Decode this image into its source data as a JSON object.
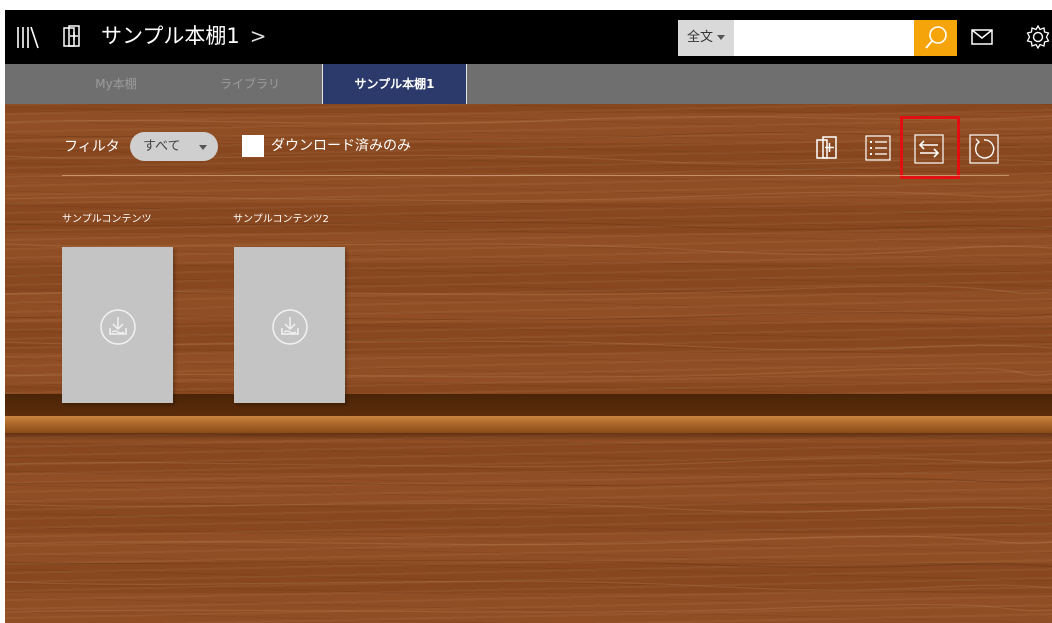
{
  "header": {
    "shelf_title": "サンプル本棚1",
    "chevron": ">",
    "search_scope": "全文",
    "search_value": "",
    "search_placeholder": ""
  },
  "tabs": [
    {
      "label": "My本棚",
      "active": false
    },
    {
      "label": "ライブラリ",
      "active": false
    },
    {
      "label": "サンプル本棚1",
      "active": true
    }
  ],
  "filter": {
    "label": "フィルタ",
    "selected": "すべて",
    "downloaded_only_label": "ダウンロード済みのみ",
    "downloaded_only_checked": false
  },
  "toolbar": {
    "icons": [
      "add-to-shelf-icon",
      "list-view-icon",
      "sort-swap-icon",
      "refresh-icon"
    ],
    "highlighted": "sort-swap-icon"
  },
  "books": [
    {
      "title": "サンプルコンテンツ",
      "status_icon": "download-icon"
    },
    {
      "title": "サンプルコンテンツ2",
      "status_icon": "download-icon"
    }
  ],
  "colors": {
    "topbar": "#000000",
    "tabbar": "#6f6f6f",
    "tab_active": "#2c3a6b",
    "search_button": "#f5a40a",
    "wood": "#8d4a20",
    "highlight": "#e01010"
  }
}
